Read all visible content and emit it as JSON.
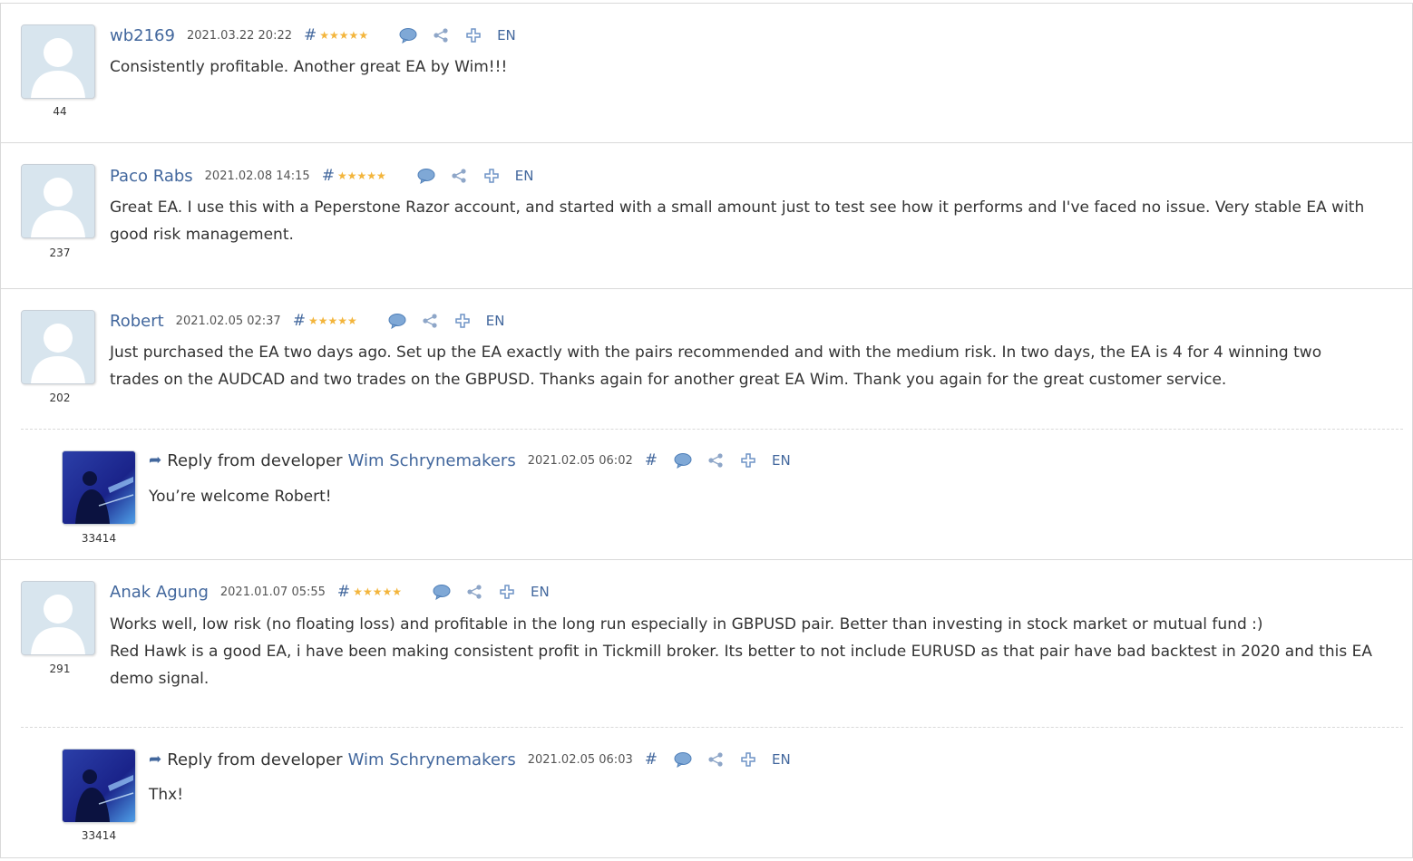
{
  "reviews": [
    {
      "author": "wb2169",
      "date": "2021.03.22 20:22",
      "rating_count": "44",
      "hash": "#",
      "lang": "EN",
      "text_lines": [
        "Consistently profitable. Another great EA by Wim!!!"
      ],
      "stars": 5
    },
    {
      "author": "Paco Rabs",
      "date": "2021.02.08 14:15",
      "rating_count": "237",
      "hash": "#",
      "lang": "EN",
      "text_lines": [
        "Great EA. I use this with a Peperstone Razor account, and started with a small amount just to test see how it performs and I've faced no issue. Very stable EA with",
        "good risk management."
      ],
      "stars": 5
    },
    {
      "author": "Robert",
      "date": "2021.02.05 02:37",
      "rating_count": "202",
      "hash": "#",
      "lang": "EN",
      "text_lines": [
        "Just purchased the EA two days ago. Set up the EA exactly with the pairs recommended and with the medium risk. In two days, the EA is 4 for 4 winning two",
        "trades on the AUDCAD and two trades on the GBPUSD. Thanks again for another great EA Wim. Thank you again for the great customer service."
      ],
      "stars": 5,
      "reply": {
        "label": "Reply from developer",
        "author": "Wim Schrynemakers",
        "date": "2021.02.05 06:02",
        "hash": "#",
        "lang": "EN",
        "rating_count": "33414",
        "text": "You’re welcome Robert!"
      }
    },
    {
      "author": "Anak Agung",
      "date": "2021.01.07 05:55",
      "rating_count": "291",
      "hash": "#",
      "lang": "EN",
      "text_lines": [
        "Works well, low risk (no floating loss) and profitable in the long run especially in GBPUSD pair. Better than investing in stock market or mutual fund :)",
        "Red Hawk is a good EA, i have been making consistent profit in Tickmill broker. Its better to not include EURUSD as that pair have bad backtest in 2020 and this EA",
        "demo signal."
      ],
      "stars": 5,
      "reply": {
        "label": "Reply from developer",
        "author": "Wim Schrynemakers",
        "date": "2021.02.05 06:03",
        "hash": "#",
        "lang": "EN",
        "rating_count": "33414",
        "text": "Thx!"
      }
    }
  ],
  "colors": {
    "link": "#42679d",
    "star": "#f3b53c",
    "border": "#d9d9d9",
    "text": "#333333"
  },
  "icons": [
    "comment-icon",
    "share-icon",
    "plus-icon",
    "reply-arrow-icon",
    "star-icon",
    "user-placeholder-icon"
  ]
}
